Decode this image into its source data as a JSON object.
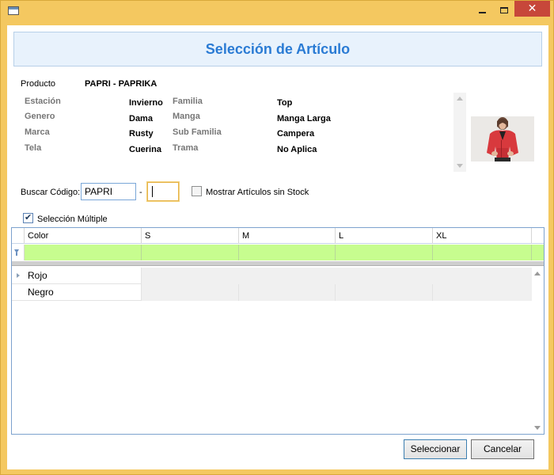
{
  "window": {
    "title": "",
    "buttons": {
      "minimize": "—",
      "maximize": "□",
      "close": "✕"
    },
    "accent_color": "#f4c860"
  },
  "header": {
    "title": "Selección de Artículo",
    "color": "#2a7bd4"
  },
  "product": {
    "label": "Producto",
    "value": "PAPRI - PAPRIKA"
  },
  "attributes": {
    "estacion": {
      "label": "Estación",
      "value": "Invierno"
    },
    "genero": {
      "label": "Genero",
      "value": "Dama"
    },
    "marca": {
      "label": "Marca",
      "value": "Rusty"
    },
    "tela": {
      "label": "Tela",
      "value": "Cuerina"
    },
    "familia": {
      "label": "Familia",
      "value": "Top"
    },
    "manga": {
      "label": "Manga",
      "value": "Manga Larga"
    },
    "sub_familia": {
      "label": "Sub Familia",
      "value": "Campera"
    },
    "trama": {
      "label": "Trama",
      "value": "No Aplica"
    }
  },
  "search": {
    "label": "Buscar Código:",
    "code_value": "PAPRI",
    "separator": "-",
    "code2_value": "",
    "show_without_stock_label": "Mostrar Artículos sin Stock",
    "show_without_stock_checked": false
  },
  "multi_select": {
    "label": "Selección Múltiple",
    "checked": true
  },
  "grid": {
    "columns": [
      "Color",
      "S",
      "M",
      "L",
      "XL"
    ],
    "rows": [
      {
        "color": "Rojo",
        "sizes": []
      },
      {
        "color": "Negro",
        "sizes": [
          "",
          "",
          "",
          ""
        ]
      }
    ],
    "filter_row_color": "#c7fd8f"
  },
  "actions": {
    "select_label": "Seleccionar",
    "cancel_label": "Cancelar"
  }
}
